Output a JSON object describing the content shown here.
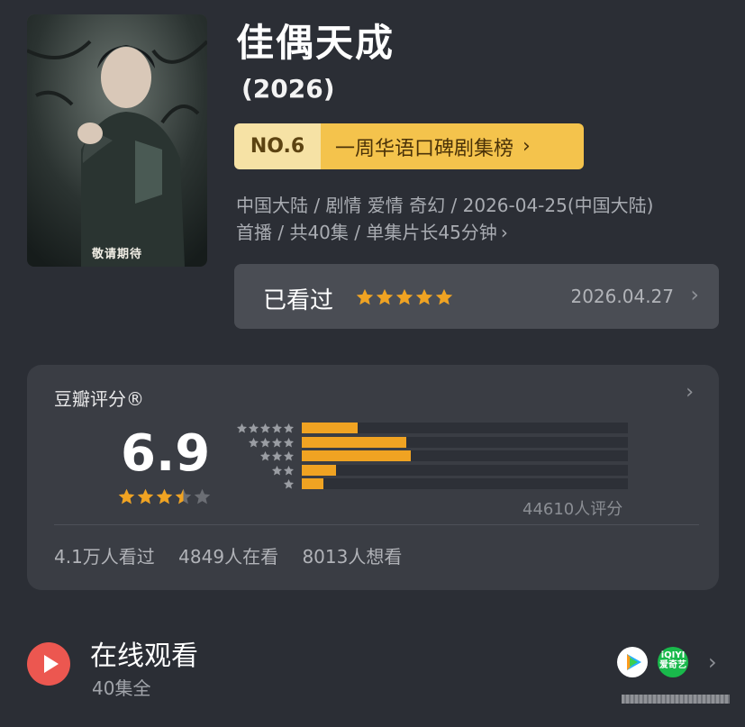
{
  "poster": {
    "badge_text": "敬请期待",
    "poster_title": "佳偶天成"
  },
  "title": "佳偶天成",
  "year": "(2026)",
  "ranking": {
    "number": "NO.6",
    "label": "一周华语口碑剧集榜"
  },
  "meta": {
    "line1": "中国大陆 / 剧情 爱情 奇幻 / 2026-04-25(中国大陆)",
    "line2": "首播 / 共40集 / 单集片长45分钟"
  },
  "watched": {
    "label": "已看过",
    "user_stars": 5,
    "date": "2026.04.27"
  },
  "rating": {
    "title": "豆瓣评分®",
    "score": "6.9",
    "score_stars": 3.5,
    "distribution": [
      {
        "stars": 5,
        "fraction": 0.17
      },
      {
        "stars": 4,
        "fraction": 0.32
      },
      {
        "stars": 3,
        "fraction": 0.335
      },
      {
        "stars": 2,
        "fraction": 0.105
      },
      {
        "stars": 1,
        "fraction": 0.065
      }
    ],
    "count_text": "44610人评分",
    "stats": [
      "4.1万人看过",
      "4849人在看",
      "8013人想看"
    ]
  },
  "online": {
    "title": "在线观看",
    "subtitle": "40集全",
    "providers": [
      {
        "name": "tencent-video",
        "text": ""
      },
      {
        "name": "iqiyi",
        "text": "iQIYI 爱奇艺"
      }
    ]
  },
  "colors": {
    "background": "#2b2e35",
    "card": "#3a3d44",
    "accent_gold": "#f4c34c",
    "bar_orange": "#f0a322",
    "play_red": "#ec5750"
  }
}
